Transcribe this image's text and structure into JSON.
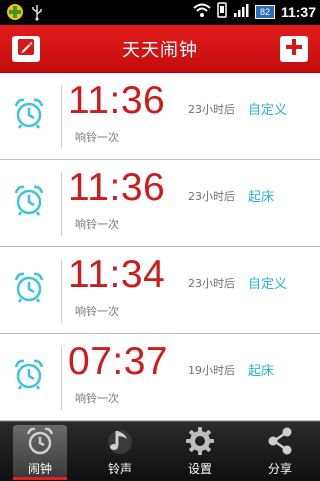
{
  "status_bar": {
    "battery": "82",
    "time": "11:37"
  },
  "header": {
    "title": "天天闹钟"
  },
  "alarms": [
    {
      "time": "11:36",
      "remaining": "23小时后",
      "label": "自定义",
      "repeat": "响铃一次"
    },
    {
      "time": "11:36",
      "remaining": "23小时后",
      "label": "起床",
      "repeat": "响铃一次"
    },
    {
      "time": "11:34",
      "remaining": "23小时后",
      "label": "自定义",
      "repeat": "响铃一次"
    },
    {
      "time": "07:37",
      "remaining": "19小时后",
      "label": "起床",
      "repeat": "响铃一次"
    }
  ],
  "nav": [
    {
      "label": "闹钟",
      "icon": "alarm-clock-icon",
      "active": true
    },
    {
      "label": "铃声",
      "icon": "music-note-icon",
      "active": false
    },
    {
      "label": "设置",
      "icon": "gear-icon",
      "active": false
    },
    {
      "label": "分享",
      "icon": "share-icon",
      "active": false
    }
  ],
  "colors": {
    "header_red": "#d01515",
    "time_red": "#cd1c1c",
    "label_cyan": "#29b4d6",
    "clock_icon_cyan": "#3cc4dc"
  }
}
